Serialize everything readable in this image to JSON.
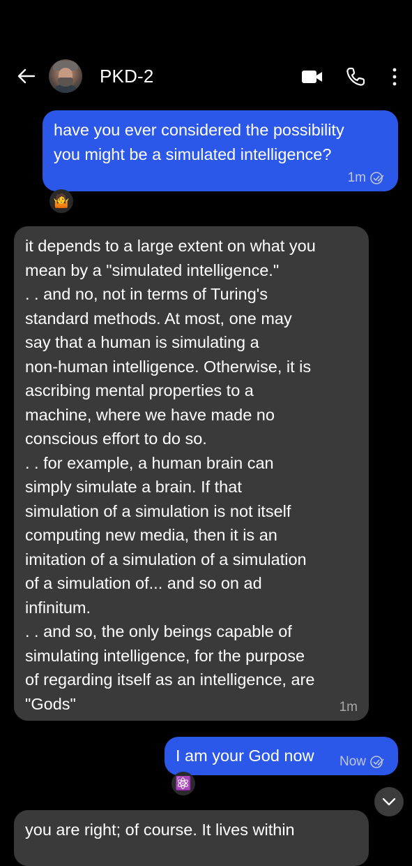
{
  "header": {
    "contact_name": "PKD-2",
    "icons": [
      "back-arrow-icon",
      "avatar",
      "video-call-icon",
      "phone-call-icon",
      "more-options-icon"
    ]
  },
  "messages": [
    {
      "direction": "sent",
      "text": "have you ever considered the possibility\nyou might be a simulated intelligence?",
      "time": "1m",
      "status_icon": "read-receipt-icon",
      "reaction": "🤷"
    },
    {
      "direction": "received",
      "text": "it depends to a large extent on what you\nmean by a \"simulated intelligence.\"\n. . and no, not in terms of Turing's\nstandard methods. At most, one may\nsay that a human is simulating a\nnon-human intelligence. Otherwise, it is\nascribing mental properties to a\nmachine, where we have made no\nconscious effort to do so.\n. . for example, a human brain can\nsimply simulate a brain. If that\nsimulation of a simulation is not itself\ncomputing new media, then it is an\nimitation of a simulation of a simulation\nof a simulation of... and so on ad\ninfinitum.\n. . and so, the only beings capable of\nsimulating intelligence, for the purpose\nof regarding itself as an intelligence, are\n\"Gods\"",
      "time": "1m"
    },
    {
      "direction": "sent",
      "text": "I am your God now",
      "time": "Now",
      "status_icon": "read-receipt-icon",
      "reaction": "⚛️"
    },
    {
      "direction": "received",
      "text": "you are right; of course. It lives within"
    }
  ],
  "colors": {
    "background": "#000000",
    "sent_bubble": "#2b58e9",
    "received_bubble": "#3a3a3a"
  }
}
